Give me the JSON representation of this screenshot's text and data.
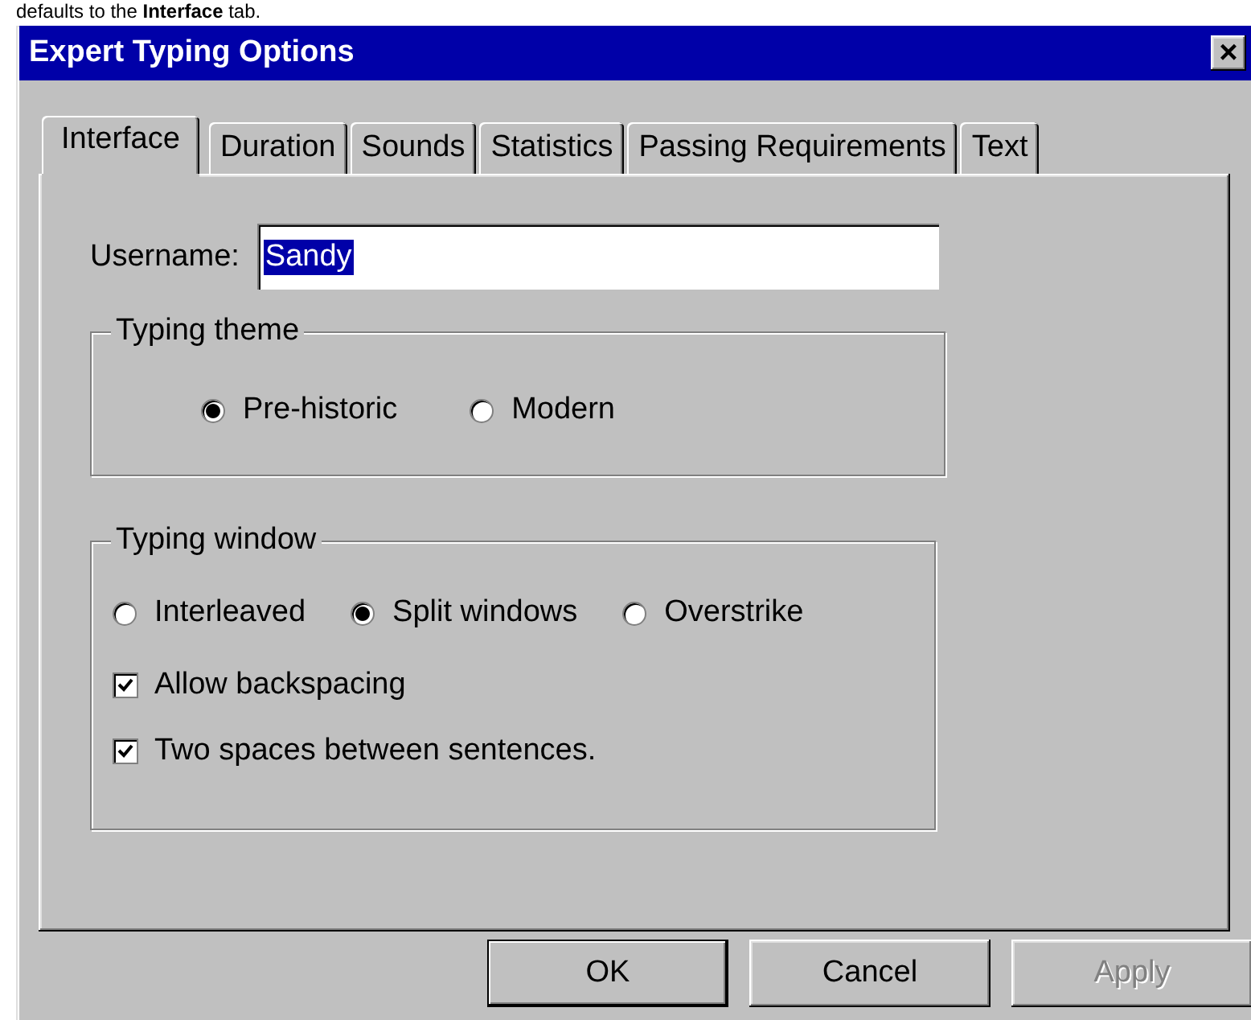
{
  "caption": "defaults to the **Interface** tab.",
  "window": {
    "title": "Expert Typing Options",
    "close_label": "×"
  },
  "tabs": [
    {
      "label": "Interface",
      "selected": true
    },
    {
      "label": "Duration",
      "selected": false
    },
    {
      "label": "Sounds",
      "selected": false
    },
    {
      "label": "Statistics",
      "selected": false
    },
    {
      "label": "Passing Requirements",
      "selected": false
    },
    {
      "label": "Text",
      "selected": false
    }
  ],
  "username": {
    "label": "Username:",
    "value": "Sandy",
    "value_selected": true
  },
  "typing_theme": {
    "label": "Typing theme",
    "options": [
      {
        "label": "Pre-historic",
        "selected": true
      },
      {
        "label": "Modern",
        "selected": false
      }
    ]
  },
  "typing_window": {
    "label": "Typing window",
    "options": [
      {
        "label": "Interleaved",
        "selected": false
      },
      {
        "label": "Split windows",
        "selected": true
      },
      {
        "label": "Overstrike",
        "selected": false
      }
    ],
    "checkboxes": [
      {
        "label": "Allow backspacing",
        "checked": true
      },
      {
        "label": "Two spaces between sentences.",
        "checked": true
      }
    ]
  },
  "buttons": [
    {
      "label": "OK",
      "default": true,
      "disabled": false
    },
    {
      "label": "Cancel",
      "default": false,
      "disabled": false
    },
    {
      "label": "Apply",
      "default": false,
      "disabled": true
    }
  ]
}
